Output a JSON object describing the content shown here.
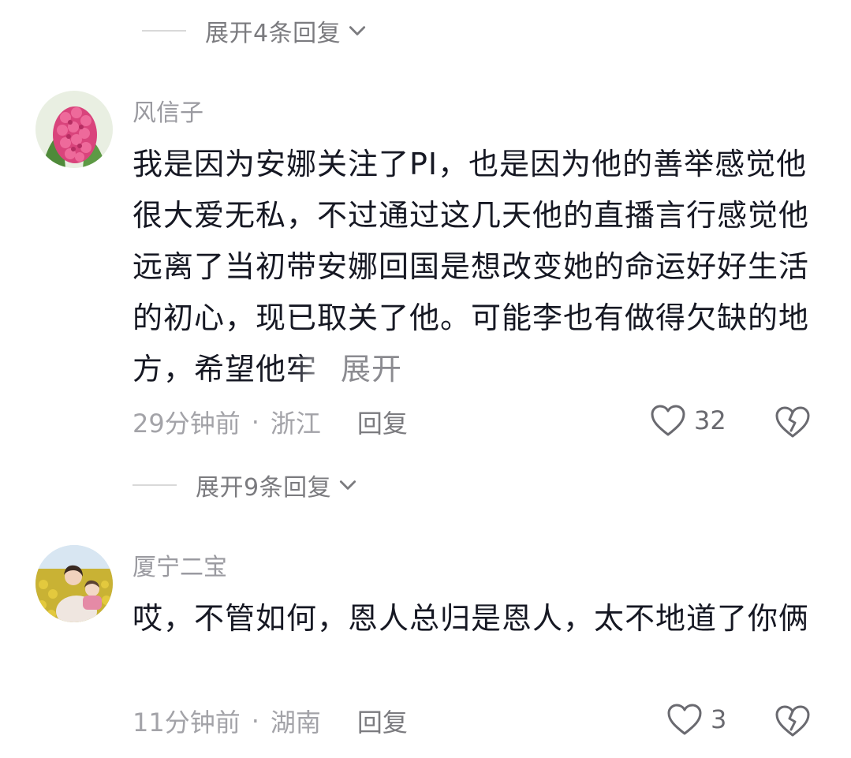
{
  "expand_top": {
    "label": "展开4条回复"
  },
  "comments": [
    {
      "username": "风信子",
      "text": "我是因为安娜关注了PI，也是因为他的善举感觉他很大爱无私，不过通过这几天他的直播言行感觉他远离了当初带安娜回国是想改变她的命运好好生活的初心，现已取关了他。可能李也有做得欠缺的地方，希望他牢",
      "more": "展开",
      "time": "29分钟前",
      "sep": "·",
      "location": "浙江",
      "reply": "回复",
      "likes": "32",
      "expand_replies": "展开9条回复"
    },
    {
      "username": "厦宁二宝",
      "text": "哎，不管如何，恩人总归是恩人，太不地道了你俩",
      "time": "11分钟前",
      "sep": "·",
      "location": "湖南",
      "reply": "回复",
      "likes": "3"
    }
  ],
  "icons": {
    "like": "heart-outline-icon",
    "dislike": "broken-heart-icon",
    "expand": "chevron-down-icon"
  },
  "colors": {
    "text": "#161823",
    "secondary": "#9a9aa0",
    "icon": "#6a6a70"
  }
}
